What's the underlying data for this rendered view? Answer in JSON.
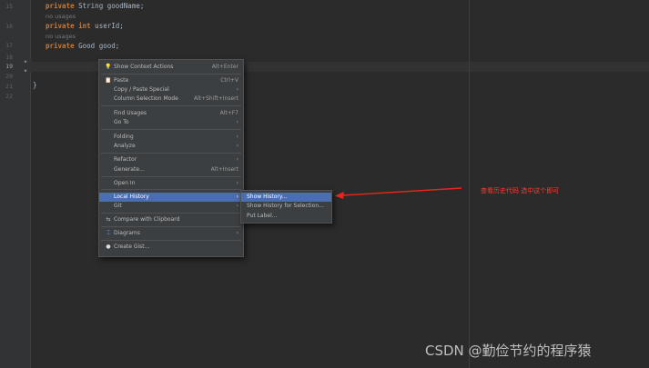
{
  "editor": {
    "line_numbers": [
      {
        "n": "15",
        "current": false
      },
      {
        "n": "16",
        "current": false
      },
      {
        "n": "17",
        "current": false
      },
      {
        "n": "18",
        "current": false
      },
      {
        "n": "19",
        "current": true
      },
      {
        "n": "20",
        "current": false
      },
      {
        "n": "21",
        "current": false
      },
      {
        "n": "22",
        "current": false
      }
    ],
    "code_lines": [
      {
        "keyword": "private",
        "rest": " String goodName;"
      },
      {
        "keyword": "private int",
        "rest": " userId;"
      },
      {
        "keyword": "private",
        "rest": " Good good;"
      }
    ],
    "usage_hint": "no usages",
    "closing_brace": "}"
  },
  "context_menu": {
    "items": [
      {
        "icon": "lightbulb-icon",
        "glyph": "💡",
        "label": "Show Context Actions",
        "shortcut": "Alt+Enter",
        "submenu": false,
        "selected": false
      },
      {
        "icon": "clipboard-icon",
        "glyph": "📋",
        "label": "Paste",
        "shortcut": "Ctrl+V",
        "submenu": false,
        "selected": false
      },
      {
        "icon": "",
        "glyph": "",
        "label": "Copy / Paste Special",
        "shortcut": "",
        "submenu": true,
        "selected": false
      },
      {
        "icon": "",
        "glyph": "",
        "label": "Column Selection Mode",
        "shortcut": "Alt+Shift+Insert",
        "submenu": false,
        "selected": false
      },
      {
        "icon": "",
        "glyph": "",
        "label": "Find Usages",
        "shortcut": "Alt+F7",
        "submenu": false,
        "selected": false
      },
      {
        "icon": "",
        "glyph": "",
        "label": "Go To",
        "shortcut": "",
        "submenu": true,
        "selected": false
      },
      {
        "icon": "",
        "glyph": "",
        "label": "Folding",
        "shortcut": "",
        "submenu": true,
        "selected": false
      },
      {
        "icon": "",
        "glyph": "",
        "label": "Analyze",
        "shortcut": "",
        "submenu": true,
        "selected": false
      },
      {
        "icon": "",
        "glyph": "",
        "label": "Refactor",
        "shortcut": "",
        "submenu": true,
        "selected": false
      },
      {
        "icon": "",
        "glyph": "",
        "label": "Generate...",
        "shortcut": "Alt+Insert",
        "submenu": false,
        "selected": false
      },
      {
        "icon": "",
        "glyph": "",
        "label": "Open In",
        "shortcut": "",
        "submenu": true,
        "selected": false
      },
      {
        "icon": "",
        "glyph": "",
        "label": "Local History",
        "shortcut": "",
        "submenu": true,
        "selected": true
      },
      {
        "icon": "",
        "glyph": "",
        "label": "Git",
        "shortcut": "",
        "submenu": true,
        "selected": false
      },
      {
        "icon": "compare-icon",
        "glyph": "⇆",
        "label": "Compare with Clipboard",
        "shortcut": "",
        "submenu": false,
        "selected": false
      },
      {
        "icon": "diagram-icon",
        "glyph": "⌶",
        "label": "Diagrams",
        "shortcut": "",
        "submenu": true,
        "selected": false
      },
      {
        "icon": "github-icon",
        "glyph": "●",
        "label": "Create Gist...",
        "shortcut": "",
        "submenu": false,
        "selected": false
      }
    ]
  },
  "local_history_submenu": {
    "items": [
      {
        "label": "Show History...",
        "selected": true
      },
      {
        "label": "Show History for Selection...",
        "selected": false
      },
      {
        "label": "Put Label...",
        "selected": false
      }
    ]
  },
  "annotation": {
    "text": "查看历史代码 选中这个即可",
    "color": "#ff3b30"
  },
  "watermark": "CSDN @勤俭节约的程序猿",
  "colors": {
    "background": "#2b2b2b",
    "menu_background": "#3c3f41",
    "selection": "#4b6eaf",
    "keyword": "#cc7832"
  }
}
